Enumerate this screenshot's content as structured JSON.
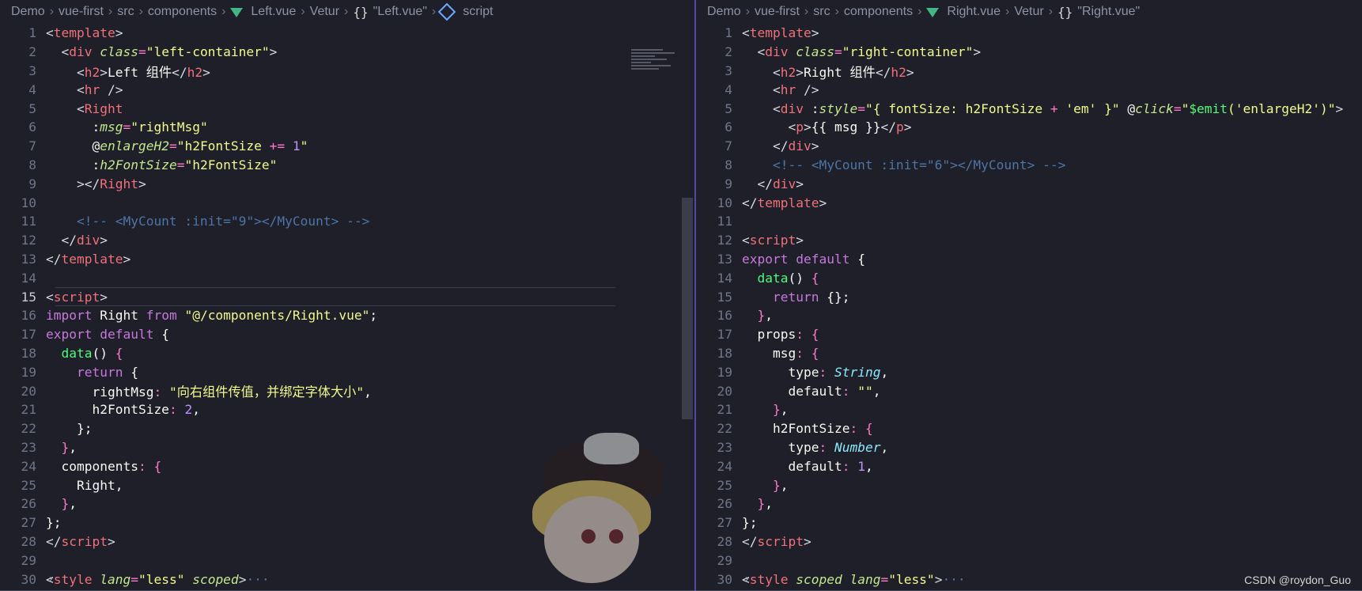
{
  "left": {
    "breadcrumb": [
      "Demo",
      "vue-first",
      "src",
      "components",
      "Left.vue",
      "Vetur",
      "\"Left.vue\"",
      "script"
    ],
    "lines": [
      {
        "n": "1",
        "html": [
          [
            "t-ang",
            "<"
          ],
          [
            "t-name",
            "template"
          ],
          [
            "t-ang",
            ">"
          ]
        ]
      },
      {
        "n": "2",
        "html": [
          [
            "t-ang",
            "  <"
          ],
          [
            "t-name",
            "div "
          ],
          [
            "t-attr",
            "class"
          ],
          [
            "t-op",
            "="
          ],
          [
            "t-str",
            "\"left-container\""
          ],
          [
            "t-ang",
            ">"
          ]
        ]
      },
      {
        "n": "3",
        "html": [
          [
            "t-ang",
            "    <"
          ],
          [
            "t-name",
            "h2"
          ],
          [
            "t-ang",
            ">"
          ],
          [
            "t-punc",
            "Left 组件"
          ],
          [
            "t-ang",
            "</"
          ],
          [
            "t-name",
            "h2"
          ],
          [
            "t-ang",
            ">"
          ]
        ]
      },
      {
        "n": "4",
        "html": [
          [
            "t-ang",
            "    <"
          ],
          [
            "t-name",
            "hr "
          ],
          [
            "t-ang",
            "/>"
          ]
        ]
      },
      {
        "n": "5",
        "html": [
          [
            "t-ang",
            "    <"
          ],
          [
            "t-name",
            "Right"
          ]
        ]
      },
      {
        "n": "6",
        "html": [
          [
            "t-punc",
            "      :"
          ],
          [
            "t-attr",
            "msg"
          ],
          [
            "t-op",
            "="
          ],
          [
            "t-str",
            "\"rightMsg\""
          ]
        ]
      },
      {
        "n": "7",
        "html": [
          [
            "t-punc",
            "      @"
          ],
          [
            "t-attr",
            "enlargeH2"
          ],
          [
            "t-op",
            "="
          ],
          [
            "t-str",
            "\"h2FontSize "
          ],
          [
            "t-op",
            "+="
          ],
          [
            "t-num",
            " 1"
          ],
          [
            "t-str",
            "\""
          ]
        ]
      },
      {
        "n": "8",
        "html": [
          [
            "t-punc",
            "      :"
          ],
          [
            "t-attr",
            "h2FontSize"
          ],
          [
            "t-op",
            "="
          ],
          [
            "t-str",
            "\"h2FontSize\""
          ]
        ]
      },
      {
        "n": "9",
        "html": [
          [
            "t-ang",
            "    ></"
          ],
          [
            "t-name",
            "Right"
          ],
          [
            "t-ang",
            ">"
          ]
        ]
      },
      {
        "n": "10",
        "html": []
      },
      {
        "n": "11",
        "html": [
          [
            "t-com",
            "    <!-- <MyCount :init=\"9\"></MyCount> -->"
          ]
        ]
      },
      {
        "n": "12",
        "html": [
          [
            "t-ang",
            "  </"
          ],
          [
            "t-name",
            "div"
          ],
          [
            "t-ang",
            ">"
          ]
        ]
      },
      {
        "n": "13",
        "html": [
          [
            "t-ang",
            "</"
          ],
          [
            "t-name",
            "template"
          ],
          [
            "t-ang",
            ">"
          ]
        ]
      },
      {
        "n": "14",
        "html": []
      },
      {
        "n": "15",
        "html": [
          [
            "t-ang",
            "<"
          ],
          [
            "t-name",
            "script"
          ],
          [
            "t-ang",
            ">"
          ]
        ]
      },
      {
        "n": "16",
        "html": [
          [
            "t-kw",
            "import "
          ],
          [
            "t-prop",
            "Right "
          ],
          [
            "t-kw",
            "from "
          ],
          [
            "t-str",
            "\"@/components/Right.vue\""
          ],
          [
            "t-punc",
            ";"
          ]
        ]
      },
      {
        "n": "17",
        "html": [
          [
            "t-kw",
            "export "
          ],
          [
            "t-kw",
            "default "
          ],
          [
            "t-punc",
            "{"
          ]
        ]
      },
      {
        "n": "18",
        "html": [
          [
            "t-func",
            "  data"
          ],
          [
            "t-punc",
            "() "
          ],
          [
            "t-op",
            "{"
          ]
        ]
      },
      {
        "n": "19",
        "html": [
          [
            "t-kw",
            "    return "
          ],
          [
            "t-punc",
            "{"
          ]
        ]
      },
      {
        "n": "20",
        "html": [
          [
            "t-prop",
            "      rightMsg"
          ],
          [
            "t-op",
            ": "
          ],
          [
            "t-str",
            "\"向右组件传值，并绑定字体大小\""
          ],
          [
            "t-punc",
            ","
          ]
        ]
      },
      {
        "n": "21",
        "html": [
          [
            "t-prop",
            "      h2FontSize"
          ],
          [
            "t-op",
            ": "
          ],
          [
            "t-num",
            "2"
          ],
          [
            "t-punc",
            ","
          ]
        ]
      },
      {
        "n": "22",
        "html": [
          [
            "t-punc",
            "    };"
          ]
        ]
      },
      {
        "n": "23",
        "html": [
          [
            "t-op",
            "  }"
          ],
          [
            "t-punc",
            ","
          ]
        ]
      },
      {
        "n": "24",
        "html": [
          [
            "t-prop",
            "  components"
          ],
          [
            "t-op",
            ": "
          ],
          [
            "t-op",
            "{"
          ]
        ]
      },
      {
        "n": "25",
        "html": [
          [
            "t-prop",
            "    Right"
          ],
          [
            "t-punc",
            ","
          ]
        ]
      },
      {
        "n": "26",
        "html": [
          [
            "t-op",
            "  }"
          ],
          [
            "t-punc",
            ","
          ]
        ]
      },
      {
        "n": "27",
        "html": [
          [
            "t-punc",
            "};"
          ]
        ]
      },
      {
        "n": "28",
        "html": [
          [
            "t-ang",
            "</"
          ],
          [
            "t-name",
            "script"
          ],
          [
            "t-ang",
            ">"
          ]
        ]
      },
      {
        "n": "29",
        "html": []
      },
      {
        "n": "30",
        "html": [
          [
            "t-ang",
            "<"
          ],
          [
            "t-name",
            "style "
          ],
          [
            "t-attr",
            "lang"
          ],
          [
            "t-op",
            "="
          ],
          [
            "t-str",
            "\"less\" "
          ],
          [
            "t-attr",
            "scoped"
          ],
          [
            "t-ang",
            ">"
          ],
          [
            "t-com",
            "···"
          ]
        ]
      }
    ]
  },
  "right": {
    "breadcrumb": [
      "Demo",
      "vue-first",
      "src",
      "components",
      "Right.vue",
      "Vetur",
      "\"Right.vue\""
    ],
    "lines": [
      {
        "n": "1",
        "html": [
          [
            "t-ang",
            "<"
          ],
          [
            "t-name",
            "template"
          ],
          [
            "t-ang",
            ">"
          ]
        ]
      },
      {
        "n": "2",
        "html": [
          [
            "t-ang",
            "  <"
          ],
          [
            "t-name",
            "div "
          ],
          [
            "t-attr",
            "class"
          ],
          [
            "t-op",
            "="
          ],
          [
            "t-str",
            "\"right-container\""
          ],
          [
            "t-ang",
            ">"
          ]
        ]
      },
      {
        "n": "3",
        "html": [
          [
            "t-ang",
            "    <"
          ],
          [
            "t-name",
            "h2"
          ],
          [
            "t-ang",
            ">"
          ],
          [
            "t-punc",
            "Right 组件"
          ],
          [
            "t-ang",
            "</"
          ],
          [
            "t-name",
            "h2"
          ],
          [
            "t-ang",
            ">"
          ]
        ]
      },
      {
        "n": "4",
        "html": [
          [
            "t-ang",
            "    <"
          ],
          [
            "t-name",
            "hr "
          ],
          [
            "t-ang",
            "/>"
          ]
        ]
      },
      {
        "n": "5",
        "html": [
          [
            "t-ang",
            "    <"
          ],
          [
            "t-name",
            "div "
          ],
          [
            "t-punc",
            ":"
          ],
          [
            "t-attr",
            "style"
          ],
          [
            "t-op",
            "="
          ],
          [
            "t-str",
            "\"{ fontSize: h2FontSize "
          ],
          [
            "t-op",
            "+ "
          ],
          [
            "t-str",
            "'em' }\" "
          ],
          [
            "t-punc",
            "@"
          ],
          [
            "t-attr",
            "click"
          ],
          [
            "t-op",
            "="
          ],
          [
            "t-str",
            "\""
          ],
          [
            "t-func",
            "$emit"
          ],
          [
            "t-str",
            "('enlargeH2')\""
          ],
          [
            "t-ang",
            ">"
          ]
        ]
      },
      {
        "n": "6",
        "html": [
          [
            "t-ang",
            "      <"
          ],
          [
            "t-name",
            "p"
          ],
          [
            "t-ang",
            ">"
          ],
          [
            "t-punc",
            "{{ msg }}"
          ],
          [
            "t-ang",
            "</"
          ],
          [
            "t-name",
            "p"
          ],
          [
            "t-ang",
            ">"
          ]
        ]
      },
      {
        "n": "7",
        "html": [
          [
            "t-ang",
            "    </"
          ],
          [
            "t-name",
            "div"
          ],
          [
            "t-ang",
            ">"
          ]
        ]
      },
      {
        "n": "8",
        "html": [
          [
            "t-com",
            "    <!-- <MyCount :init=\"6\"></MyCount> -->"
          ]
        ]
      },
      {
        "n": "9",
        "html": [
          [
            "t-ang",
            "  </"
          ],
          [
            "t-name",
            "div"
          ],
          [
            "t-ang",
            ">"
          ]
        ]
      },
      {
        "n": "10",
        "html": [
          [
            "t-ang",
            "</"
          ],
          [
            "t-name",
            "template"
          ],
          [
            "t-ang",
            ">"
          ]
        ]
      },
      {
        "n": "11",
        "html": []
      },
      {
        "n": "12",
        "html": [
          [
            "t-ang",
            "<"
          ],
          [
            "t-name",
            "script"
          ],
          [
            "t-ang",
            ">"
          ]
        ]
      },
      {
        "n": "13",
        "html": [
          [
            "t-kw",
            "export "
          ],
          [
            "t-kw",
            "default "
          ],
          [
            "t-punc",
            "{"
          ]
        ]
      },
      {
        "n": "14",
        "html": [
          [
            "t-func",
            "  data"
          ],
          [
            "t-punc",
            "() "
          ],
          [
            "t-op",
            "{"
          ]
        ]
      },
      {
        "n": "15",
        "html": [
          [
            "t-kw",
            "    return "
          ],
          [
            "t-punc",
            "{};"
          ]
        ]
      },
      {
        "n": "16",
        "html": [
          [
            "t-op",
            "  }"
          ],
          [
            "t-punc",
            ","
          ]
        ]
      },
      {
        "n": "17",
        "html": [
          [
            "t-prop",
            "  props"
          ],
          [
            "t-op",
            ": "
          ],
          [
            "t-op",
            "{"
          ]
        ]
      },
      {
        "n": "18",
        "html": [
          [
            "t-prop",
            "    msg"
          ],
          [
            "t-op",
            ": "
          ],
          [
            "t-op",
            "{"
          ]
        ]
      },
      {
        "n": "19",
        "html": [
          [
            "t-prop",
            "      type"
          ],
          [
            "t-op",
            ": "
          ],
          [
            "t-type",
            "String"
          ],
          [
            "t-punc",
            ","
          ]
        ]
      },
      {
        "n": "20",
        "html": [
          [
            "t-prop",
            "      default"
          ],
          [
            "t-op",
            ": "
          ],
          [
            "t-str",
            "\"\""
          ],
          [
            "t-punc",
            ","
          ]
        ]
      },
      {
        "n": "21",
        "html": [
          [
            "t-op",
            "    }"
          ],
          [
            "t-punc",
            ","
          ]
        ]
      },
      {
        "n": "22",
        "html": [
          [
            "t-prop",
            "    h2FontSize"
          ],
          [
            "t-op",
            ": "
          ],
          [
            "t-op",
            "{"
          ]
        ]
      },
      {
        "n": "23",
        "html": [
          [
            "t-prop",
            "      type"
          ],
          [
            "t-op",
            ": "
          ],
          [
            "t-type",
            "Number"
          ],
          [
            "t-punc",
            ","
          ]
        ]
      },
      {
        "n": "24",
        "html": [
          [
            "t-prop",
            "      default"
          ],
          [
            "t-op",
            ": "
          ],
          [
            "t-num",
            "1"
          ],
          [
            "t-punc",
            ","
          ]
        ]
      },
      {
        "n": "25",
        "html": [
          [
            "t-op",
            "    }"
          ],
          [
            "t-punc",
            ","
          ]
        ]
      },
      {
        "n": "26",
        "html": [
          [
            "t-op",
            "  }"
          ],
          [
            "t-punc",
            ","
          ]
        ]
      },
      {
        "n": "27",
        "html": [
          [
            "t-punc",
            "};"
          ]
        ]
      },
      {
        "n": "28",
        "html": [
          [
            "t-ang",
            "</"
          ],
          [
            "t-name",
            "script"
          ],
          [
            "t-ang",
            ">"
          ]
        ]
      },
      {
        "n": "29",
        "html": []
      },
      {
        "n": "30",
        "html": [
          [
            "t-ang",
            "<"
          ],
          [
            "t-name",
            "style "
          ],
          [
            "t-attr",
            "scoped "
          ],
          [
            "t-attr",
            "lang"
          ],
          [
            "t-op",
            "="
          ],
          [
            "t-str",
            "\"less\""
          ],
          [
            "t-ang",
            ">"
          ],
          [
            "t-com",
            "···"
          ]
        ]
      }
    ]
  },
  "watermark": "CSDN @roydon_Guo"
}
